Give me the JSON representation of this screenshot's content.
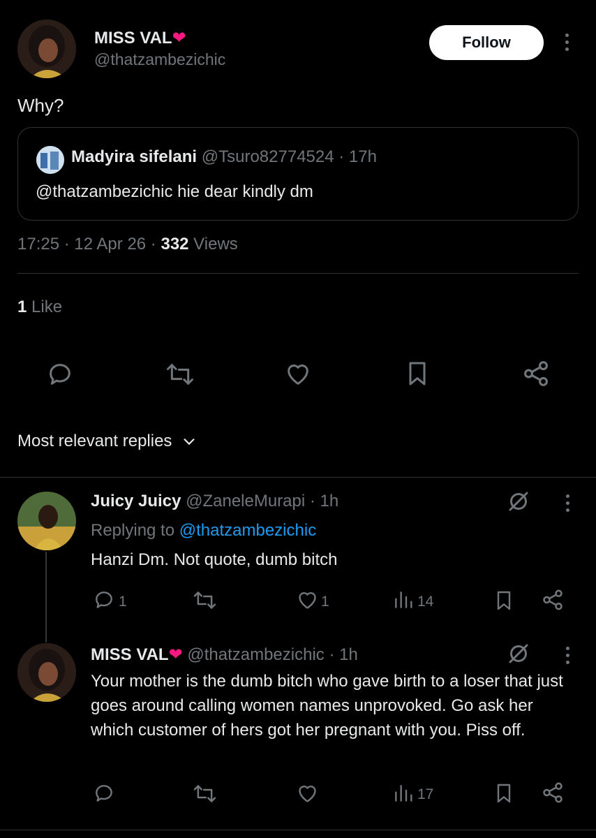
{
  "tweet": {
    "author_name": "MISS VAL",
    "author_emoji": "❤️",
    "author_handle": "@thatzambezichic",
    "follow_label": "Follow",
    "text": "Why?",
    "quote": {
      "author_name": "Madyira sifelani",
      "author_handle": "@Tsuro82774524",
      "time": "· 17h",
      "text": "@thatzambezichic hie dear kindly dm"
    },
    "meta_time": "17:25 · 12 Apr 26 · ",
    "views_count": "332",
    "views_label": " Views",
    "likes_count": "1",
    "likes_label": " Like"
  },
  "replies_header": {
    "label": "Most relevant replies"
  },
  "replies": [
    {
      "author_name": "Juicy Juicy",
      "author_handle": "@ZaneleMurapi",
      "time": "· 1h",
      "replying_prefix": "Replying to ",
      "replying_handle": "@thatzambezichic",
      "text": "Hanzi Dm. Not quote, dumb bitch",
      "reply_count": "1",
      "like_count": "1",
      "view_count": "14"
    },
    {
      "author_name": "MISS VAL",
      "author_emoji": "❤️",
      "author_handle": "@thatzambezichic",
      "time": "· 1h",
      "text": "Your mother is the dumb bitch who gave birth to a loser that just goes around calling women names unprovoked. Go ask her which customer of hers got her pregnant with you. Piss off.",
      "view_count": "17"
    }
  ],
  "colors": {
    "background": "#000000",
    "text": "#e7e9ea",
    "muted": "#71767b",
    "link": "#1d9bf0",
    "heart": "#f91880",
    "divider": "#2f3336"
  },
  "icons": [
    "reply-icon",
    "retweet-icon",
    "like-icon",
    "bookmark-icon",
    "share-icon",
    "views-icon",
    "grok-icon",
    "more-icon",
    "chevron-down-icon"
  ]
}
